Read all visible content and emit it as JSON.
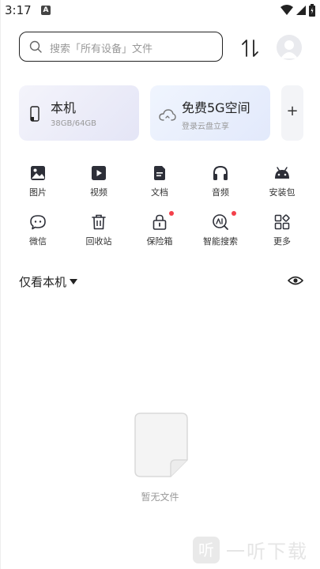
{
  "status_bar": {
    "time": "3:17",
    "notification_badge": "A"
  },
  "search": {
    "placeholder": "搜索「所有设备」文件"
  },
  "cards": {
    "local": {
      "title": "本机",
      "subtitle": "38GB/64GB"
    },
    "cloud": {
      "title": "免费5G空间",
      "subtitle": "登录云盘立享"
    },
    "add": {
      "label": "+"
    }
  },
  "categories": [
    {
      "label": "图片",
      "icon": "image-icon"
    },
    {
      "label": "视频",
      "icon": "video-icon"
    },
    {
      "label": "文档",
      "icon": "document-icon"
    },
    {
      "label": "音频",
      "icon": "headphones-icon"
    },
    {
      "label": "安装包",
      "icon": "android-icon"
    },
    {
      "label": "微信",
      "icon": "wechat-icon"
    },
    {
      "label": "回收站",
      "icon": "trash-icon"
    },
    {
      "label": "保险箱",
      "icon": "lock-icon"
    },
    {
      "label": "智能搜索",
      "icon": "smart-search-icon"
    },
    {
      "label": "更多",
      "icon": "more-grid-icon"
    }
  ],
  "filter": {
    "label": "仅看本机"
  },
  "empty_state": {
    "text": "暂无文件"
  },
  "watermark": {
    "badge": "听",
    "text": "一听下载"
  },
  "colors": {
    "accent_red": "#f3404a",
    "icon_dark": "#2d2f38"
  }
}
